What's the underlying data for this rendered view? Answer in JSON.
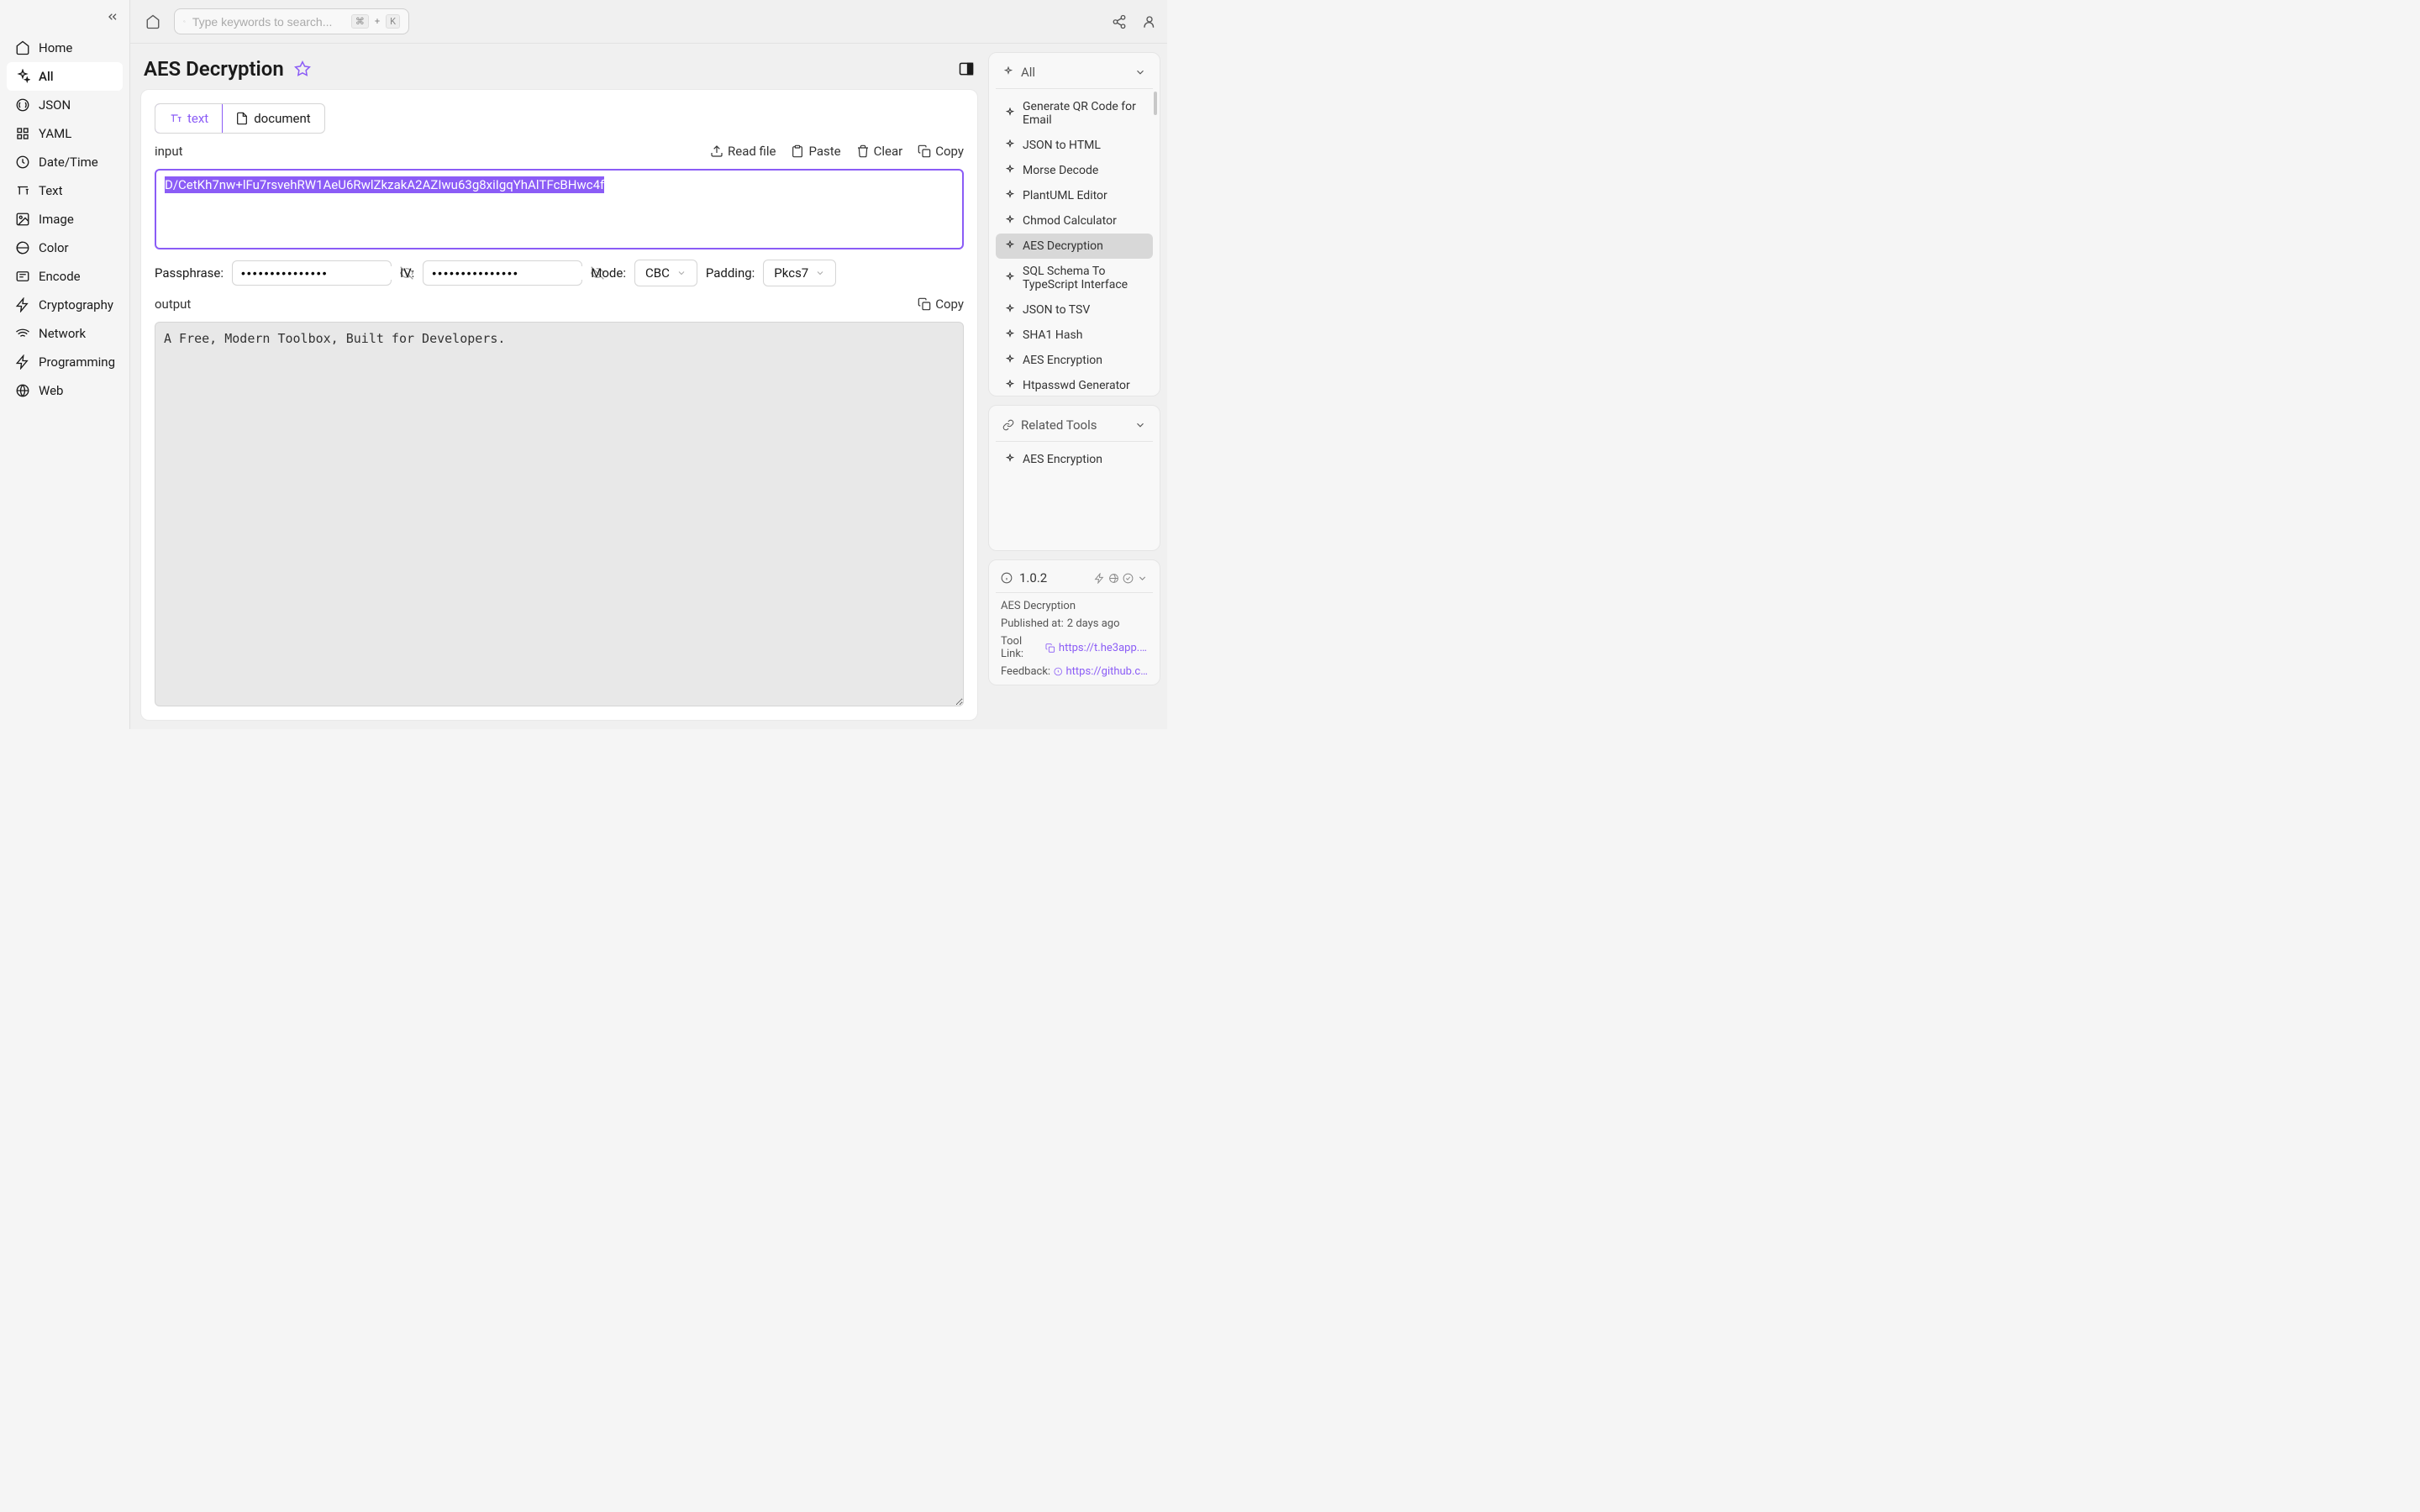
{
  "search": {
    "placeholder": "Type keywords to search...",
    "kbd1": "⌘",
    "kbd_plus": "+",
    "kbd2": "K"
  },
  "sidebar": {
    "items": [
      {
        "label": "Home"
      },
      {
        "label": "All"
      },
      {
        "label": "JSON"
      },
      {
        "label": "YAML"
      },
      {
        "label": "Date/Time"
      },
      {
        "label": "Text"
      },
      {
        "label": "Image"
      },
      {
        "label": "Color"
      },
      {
        "label": "Encode"
      },
      {
        "label": "Cryptography"
      },
      {
        "label": "Network"
      },
      {
        "label": "Programming"
      },
      {
        "label": "Web"
      }
    ]
  },
  "page": {
    "title": "AES Decryption"
  },
  "tabs": {
    "text": "text",
    "document": "document"
  },
  "input": {
    "label": "input",
    "actions": {
      "read_file": "Read file",
      "paste": "Paste",
      "clear": "Clear",
      "copy": "Copy"
    },
    "value": "D/CetKh7nw+lFu7rsvehRW1AeU6RwlZkzakA2AZIwu63g8xiIgqYhAlTFcBHwc4f"
  },
  "params": {
    "passphrase_label": "Passphrase:",
    "passphrase_value": "•••••••••••••••",
    "iv_label": "IV:",
    "iv_value": "•••••••••••••••",
    "mode_label": "Mode:",
    "mode_value": "CBC",
    "padding_label": "Padding:",
    "padding_value": "Pkcs7"
  },
  "output": {
    "label": "output",
    "copy": "Copy",
    "value": "A Free, Modern Toolbox, Built for Developers."
  },
  "right_panel": {
    "all_header": "All",
    "tools": [
      "Generate QR Code for Email",
      "JSON to HTML",
      "Morse Decode",
      "PlantUML Editor",
      "Chmod Calculator",
      "AES Decryption",
      "SQL Schema To TypeScript Interface",
      "JSON to TSV",
      "SHA1 Hash",
      "AES Encryption",
      "Htpasswd Generator"
    ],
    "related_header": "Related Tools",
    "related_tools": [
      "AES Encryption"
    ]
  },
  "info": {
    "version": "1.0.2",
    "name": "AES Decryption",
    "published_label": "Published at:",
    "published_value": "2 days ago",
    "tool_link_label": "Tool Link:",
    "tool_link_value": "https://t.he3app.co…",
    "feedback_label": "Feedback:",
    "feedback_value": "https://github.com/…"
  }
}
